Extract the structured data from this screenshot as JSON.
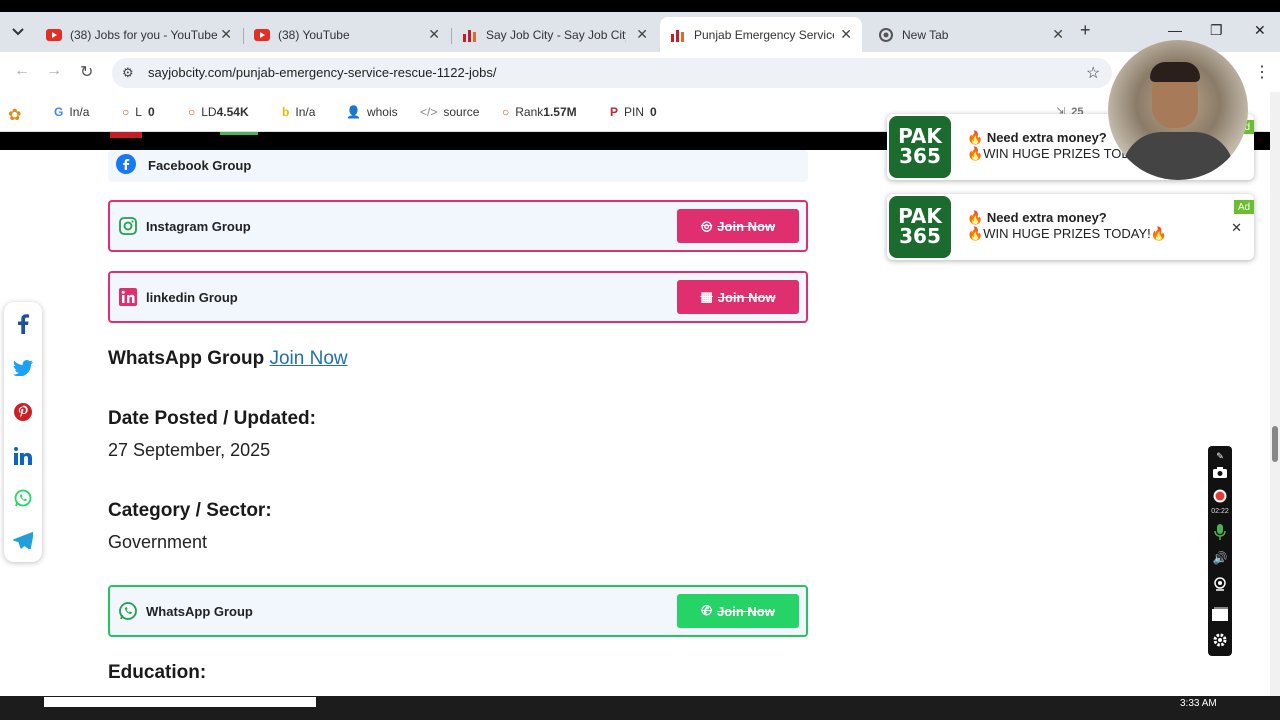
{
  "browser": {
    "tabs": [
      {
        "title": "(38) Jobs for you - YouTube",
        "icon": "youtube-icon"
      },
      {
        "title": "(38) YouTube",
        "icon": "youtube-icon"
      },
      {
        "title": "Say Job City - Say Job City in",
        "icon": "sayjobcity-icon"
      },
      {
        "title": "Punjab Emergency Service R",
        "icon": "sayjobcity-icon",
        "active": true
      },
      {
        "title": "New Tab",
        "icon": "chrome-icon"
      }
    ],
    "url": "sayjobcity.com/punjab-emergency-service-rescue-1122-jobs/"
  },
  "bookmarks": {
    "g_label": "I",
    "g_value": "n/a",
    "l_label": "L",
    "l_value": "0",
    "ld_label": "LD",
    "ld_value": "4.54K",
    "b_label": "I",
    "b_value": "n/a",
    "whois": "whois",
    "source": "source",
    "rank_label": "Rank",
    "rank_value": "1.57M",
    "pin_label": "PIN",
    "pin_value": "0",
    "extra_value": "25"
  },
  "groups": {
    "facebook": {
      "label": "Facebook Group"
    },
    "instagram": {
      "label": "Instagram Group",
      "button": "Join Now"
    },
    "linkedin": {
      "label": "linkedin Group",
      "button": "Join Now"
    },
    "whatsapp": {
      "label": "WhatsApp Group",
      "button": "Join Now"
    }
  },
  "content": {
    "whatsapp_heading": "WhatsApp Group",
    "whatsapp_link": "Join Now",
    "date_heading": "Date Posted / Updated:",
    "date_value": "27 September, 2025",
    "category_heading": "Category / Sector:",
    "category_value": "Government",
    "education_heading": "Education:"
  },
  "ads": [
    {
      "logo_top": "PAK",
      "logo_bottom": "365",
      "line1": "Need extra money?",
      "line2": "WIN HUGE PRIZES TODA",
      "badge": "Ad"
    },
    {
      "logo_top": "PAK",
      "logo_bottom": "365",
      "line1": "Need extra money?",
      "line2": "WIN HUGE PRIZES TODAY!",
      "badge": "Ad"
    }
  ],
  "recorder": {
    "time": "02:22"
  },
  "taskbar": {
    "clock": "3:33 AM"
  },
  "colors": {
    "accent_pink": "#e02f6f",
    "whatsapp_green": "#25d366",
    "link_blue": "#1f6fb2"
  }
}
